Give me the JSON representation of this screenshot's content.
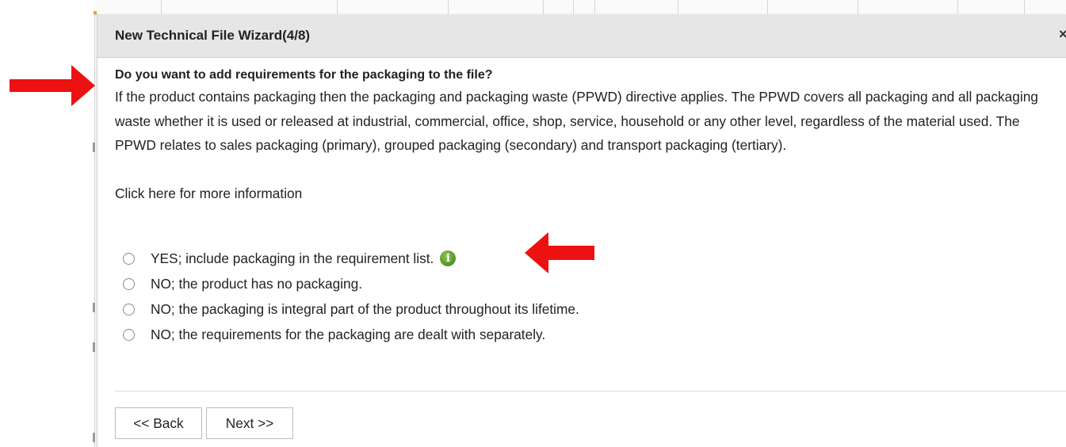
{
  "dialog": {
    "title": "New Technical File Wizard(4/8)",
    "close_glyph": "×",
    "question": "Do you want to add requirements for the packaging to the file?",
    "description": "If the product contains packaging then the packaging and packaging waste (PPWD) directive applies. The PPWD covers all packaging and all packaging waste whether it is used or released at industrial, commercial, office, shop, service, household or any other level, regardless of the material used. The PPWD relates to sales packaging (primary), grouped packaging (secondary) and transport packaging (tertiary).",
    "more_info_link": "Click here for more information",
    "options": [
      {
        "label": "YES; include packaging in the requirement list.",
        "has_info_icon": true,
        "selected": false
      },
      {
        "label": "NO; the product has no packaging.",
        "selected": false
      },
      {
        "label": "NO; the packaging is integral part of the product throughout its lifetime.",
        "selected": false
      },
      {
        "label": "NO; the requirements for the packaging are dealt with separately.",
        "selected": false
      }
    ],
    "info_icon_glyph": "i",
    "buttons": {
      "back": "<< Back",
      "next": "Next >>"
    }
  },
  "annotations": {
    "arrow_color": "#ee1111",
    "arrows": [
      "question-pointer-arrow",
      "yes-option-pointer-arrow"
    ]
  },
  "colors": {
    "header_bg": "#e6e6e6",
    "info_icon": "#5a9a2c"
  }
}
